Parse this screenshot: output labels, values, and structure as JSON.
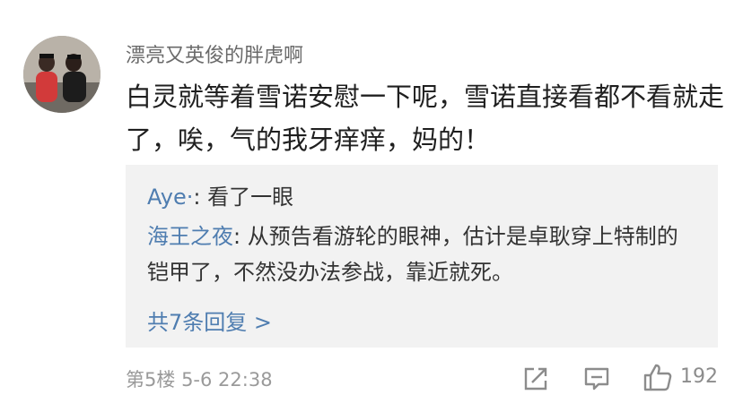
{
  "comment": {
    "username": "漂亮又英俊的胖虎啊",
    "text": "白灵就等着雪诺安慰一下呢，雪诺直接看都不看就走了，唉，气的我牙痒痒，妈的！"
  },
  "replies": [
    {
      "author": "Aye·",
      "separator": ": ",
      "text": "看了一眼"
    },
    {
      "author": "海王之夜",
      "separator": ": ",
      "text": "从预告看游轮的眼神，估计是卓耿穿上特制的铠甲了，不然没办法参战，靠近就死。"
    }
  ],
  "more_replies_label": "共7条回复 >",
  "meta": {
    "floor": "第5楼",
    "time": "5-6 22:38"
  },
  "actions": {
    "like_count": "192"
  },
  "icons": [
    "avatar-photo",
    "share-icon",
    "reply-icon",
    "like-icon"
  ],
  "colors": {
    "link": "#4f7db0",
    "meta": "#9a9a9a",
    "reply_bg": "#f2f2f2"
  }
}
